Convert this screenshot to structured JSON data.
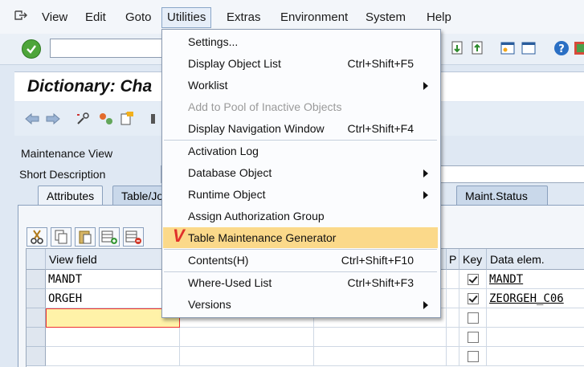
{
  "menubar": {
    "items": [
      "View",
      "Edit",
      "Goto",
      "Utilities",
      "Extras",
      "Environment",
      "System",
      "Help"
    ],
    "active": "Utilities"
  },
  "title": "Dictionary: Cha",
  "form": {
    "maintenance_view_label": "Maintenance View",
    "short_description_label": "Short Description"
  },
  "tabs": [
    "Attributes",
    "Table/Jo",
    "Maint.Status"
  ],
  "table": {
    "headers": {
      "view_field": "View field",
      "p": "P",
      "key": "Key",
      "data_elem": "Data elem."
    },
    "rows": [
      {
        "view_field": "MANDT",
        "key": true,
        "data_elem": "MANDT"
      },
      {
        "view_field": "ORGEH",
        "key": true,
        "data_elem": "ZEORGEH_C06"
      },
      {
        "view_field": "",
        "key": false,
        "data_elem": ""
      },
      {
        "view_field": "",
        "key": false,
        "data_elem": ""
      },
      {
        "view_field": "",
        "key": false,
        "data_elem": ""
      }
    ]
  },
  "dropdown": {
    "items": [
      {
        "label": "Settings...",
        "shortcut": "",
        "submenu": false,
        "disabled": false
      },
      {
        "label": "Display Object List",
        "shortcut": "Ctrl+Shift+F5",
        "submenu": false,
        "disabled": false
      },
      {
        "label": "Worklist",
        "shortcut": "",
        "submenu": true,
        "disabled": false
      },
      {
        "label": "Add to Pool of Inactive Objects",
        "shortcut": "",
        "submenu": false,
        "disabled": true
      },
      {
        "label": "Display Navigation Window",
        "shortcut": "Ctrl+Shift+F4",
        "submenu": false,
        "disabled": false
      },
      {
        "label": "Activation Log",
        "shortcut": "",
        "submenu": false,
        "disabled": false
      },
      {
        "label": "Database Object",
        "shortcut": "",
        "submenu": true,
        "disabled": false
      },
      {
        "label": "Runtime Object",
        "shortcut": "",
        "submenu": true,
        "disabled": false
      },
      {
        "label": "Assign Authorization Group",
        "shortcut": "",
        "submenu": false,
        "disabled": false
      },
      {
        "label": "Table Maintenance Generator",
        "shortcut": "",
        "submenu": false,
        "disabled": false,
        "highlighted": true
      },
      {
        "label": "Contents(H)",
        "shortcut": "Ctrl+Shift+F10",
        "submenu": false,
        "disabled": false
      },
      {
        "label": "Where-Used List",
        "shortcut": "Ctrl+Shift+F3",
        "submenu": false,
        "disabled": false
      },
      {
        "label": "Versions",
        "shortcut": "",
        "submenu": true,
        "disabled": false
      }
    ],
    "check_mark": "V"
  },
  "colors": {
    "highlight": "#fbd98a",
    "accent_check": "#e0302a",
    "ok_green": "#4da53a"
  }
}
